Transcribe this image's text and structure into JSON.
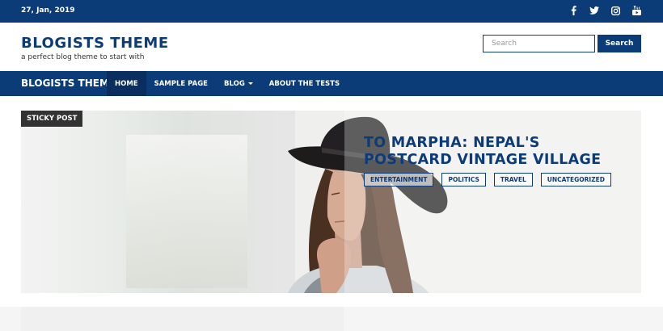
{
  "topbar": {
    "date": "27, Jan, 2019",
    "social": [
      {
        "icon": "facebook-icon"
      },
      {
        "icon": "twitter-icon"
      },
      {
        "icon": "instagram-icon"
      },
      {
        "icon": "youtube-icon"
      }
    ]
  },
  "header": {
    "site_title": "BLOGISTS THEME",
    "tagline": "a perfect blog theme to start with",
    "search_placeholder": "Search",
    "search_button": "Search"
  },
  "nav": {
    "brand": "BLOGISTS THEME",
    "items": [
      {
        "label": "HOME",
        "active": true
      },
      {
        "label": "SAMPLE PAGE"
      },
      {
        "label": "BLOG",
        "dropdown": true
      },
      {
        "label": "ABOUT THE TESTS"
      }
    ]
  },
  "hero": {
    "badge": "STICKY POST",
    "title": "TO MARPHA: NEPAL'S POSTCARD VINTAGE VILLAGE",
    "categories": [
      "ENTERTAINMENT",
      "POLITICS",
      "TRAVEL",
      "UNCATEGORIZED"
    ]
  },
  "colors": {
    "primary": "#0c3c78",
    "active_nav": "#0a2f5e",
    "badge": "#333333"
  }
}
